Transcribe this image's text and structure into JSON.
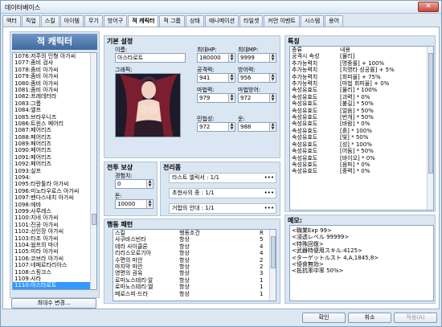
{
  "window": {
    "title": "데이터베이스",
    "close_label": "✕"
  },
  "tabs": [
    "액터",
    "직업",
    "스킬",
    "아이템",
    "무기",
    "방어구",
    "적 캐릭터",
    "적 그룹",
    "상태",
    "애니메이션",
    "타일셋",
    "커먼 이벤트",
    "시스템",
    "용어"
  ],
  "active_tab": "적 캐릭터",
  "enemy_list": {
    "header": "적 캐릭터",
    "items": [
      "1076:저주의 인형 아가씨",
      "1077:좀비 검사",
      "1078:좀비 아가씨",
      "1079:좀비 아가씨",
      "1080:좀비 아가씨",
      "1081:좀비 아가씨",
      "1082:프레데터라",
      "1083:그롬",
      "1084:엘프",
      "1085:브라우니즈",
      "1086:트윈스 페어리",
      "1087:페어리즈",
      "1088:페어리즈",
      "1089:페어리즈",
      "1090:페어리즈",
      "1091:페어리즈",
      "1092:페어리즈",
      "1093:실프",
      "1094:",
      "1095:타란툴라 아가씨",
      "1096:미노타우로스 아가씨",
      "1097:밴다스내치 아가씨",
      "1098:에바",
      "1099:사루레스",
      "1100:지네 아가씨",
      "1101:진공 아가씨",
      "1102:선인장 아가씨",
      "1103:타조 아가씨",
      "1104:웜프의 마녀",
      "1105:미라 아가씨",
      "1106:코브라 아가씨",
      "1107:네페르타리아스",
      "1108:스핑크스",
      "1109:사라",
      "1110:아스타로트"
    ],
    "selected": "1110:아스타로트",
    "max_button": "최대수 변경..."
  },
  "basic": {
    "header": "기본 설정",
    "name_label": "이름:",
    "name_value": "아스타로트",
    "maxhp_label": "최대HP:",
    "maxhp_value": "180000",
    "maxmp_label": "최대MP:",
    "maxmp_value": "9999",
    "image_label": "그래픽:",
    "atk_label": "공격력:",
    "atk_value": "941",
    "def_label": "방어력:",
    "def_value": "956",
    "mat_label": "마법력:",
    "mat_value": "979",
    "mdf_label": "마법방어:",
    "mdf_value": "972",
    "agi_label": "민첩성:",
    "agi_value": "972",
    "luk_label": "운:",
    "luk_value": "988"
  },
  "rewards": {
    "header": "전투 보상",
    "exp_label": "경험치:",
    "exp_value": "0",
    "gold_label": "돈:",
    "gold_value": "10000"
  },
  "drops": {
    "header": "전리품",
    "items": [
      "라스트 엘릭서 : 1/1",
      "초현사의 종 : 1/1",
      "거합의 안대 : 1/1"
    ]
  },
  "actions": {
    "header": "행동 패턴",
    "columns": [
      "스킬",
      "행동조건",
      "R"
    ],
    "rows": [
      [
        "사쿠바스빈타",
        "항상",
        "5"
      ],
      [
        "테라 사이클론",
        "항상",
        "4"
      ],
      [
        "리리스오로기아",
        "항상",
        "4"
      ],
      [
        "수면의 마안",
        "항상",
        "2"
      ],
      [
        "마지막 마안",
        "항상",
        "2"
      ],
      [
        "영면의 권유",
        "항상",
        "3"
      ],
      [
        "로마노스테리·알",
        "항상",
        "1"
      ],
      [
        "로마노스테리·엘",
        "항상",
        "1"
      ],
      [
        "메로스피·드라",
        "항상",
        "1"
      ]
    ]
  },
  "traits": {
    "header": "특징",
    "columns": [
      "종류",
      "내용"
    ],
    "rows": [
      [
        "공격시 속성",
        "[물리]"
      ],
      [
        "추가능력치",
        "[명중률] + 100%"
      ],
      [
        "추가능력치",
        "[치명타 성공률] + 5%"
      ],
      [
        "추가능력치",
        "[회피율] + 75%"
      ],
      [
        "추가능력치",
        "[마법 회피율] + 0%"
      ],
      [
        "속성유효도",
        "[물리] * 100%"
      ],
      [
        "속성유효도",
        "[괴력] * 0%"
      ],
      [
        "속성유효도",
        "[불길] * 50%"
      ],
      [
        "속성유효도",
        "[얼음] * 50%"
      ],
      [
        "속성유효도",
        "[번개] * 50%"
      ],
      [
        "속성유효도",
        "[바람] * 0%"
      ],
      [
        "속성유효도",
        "[흙] * 100%"
      ],
      [
        "속성유효도",
        "[빛] * 50%"
      ],
      [
        "속성유효도",
        "[성] * 100%"
      ],
      [
        "속성유효도",
        "[어둠] * 50%"
      ],
      [
        "속성유효도",
        "[바이오] * 0%"
      ],
      [
        "속성유효도",
        "[음파] * 0%"
      ],
      [
        "속성유효도",
        "[중력] * 0%"
      ]
    ]
  },
  "memo": {
    "header": "메모:",
    "lines": [
      "<職業Exp 99>",
      "<浸透レベル 99999>",
      "<特殊回復>",
      "<武器特便用スキル:4125>",
      "<ターゲットルスト 4,A,1845,8>",
      "<侵食無効>",
      "<抵抗率中率 50%>"
    ]
  },
  "footer": {
    "ok": "확인",
    "cancel": "취소",
    "apply": "적용(A)"
  }
}
